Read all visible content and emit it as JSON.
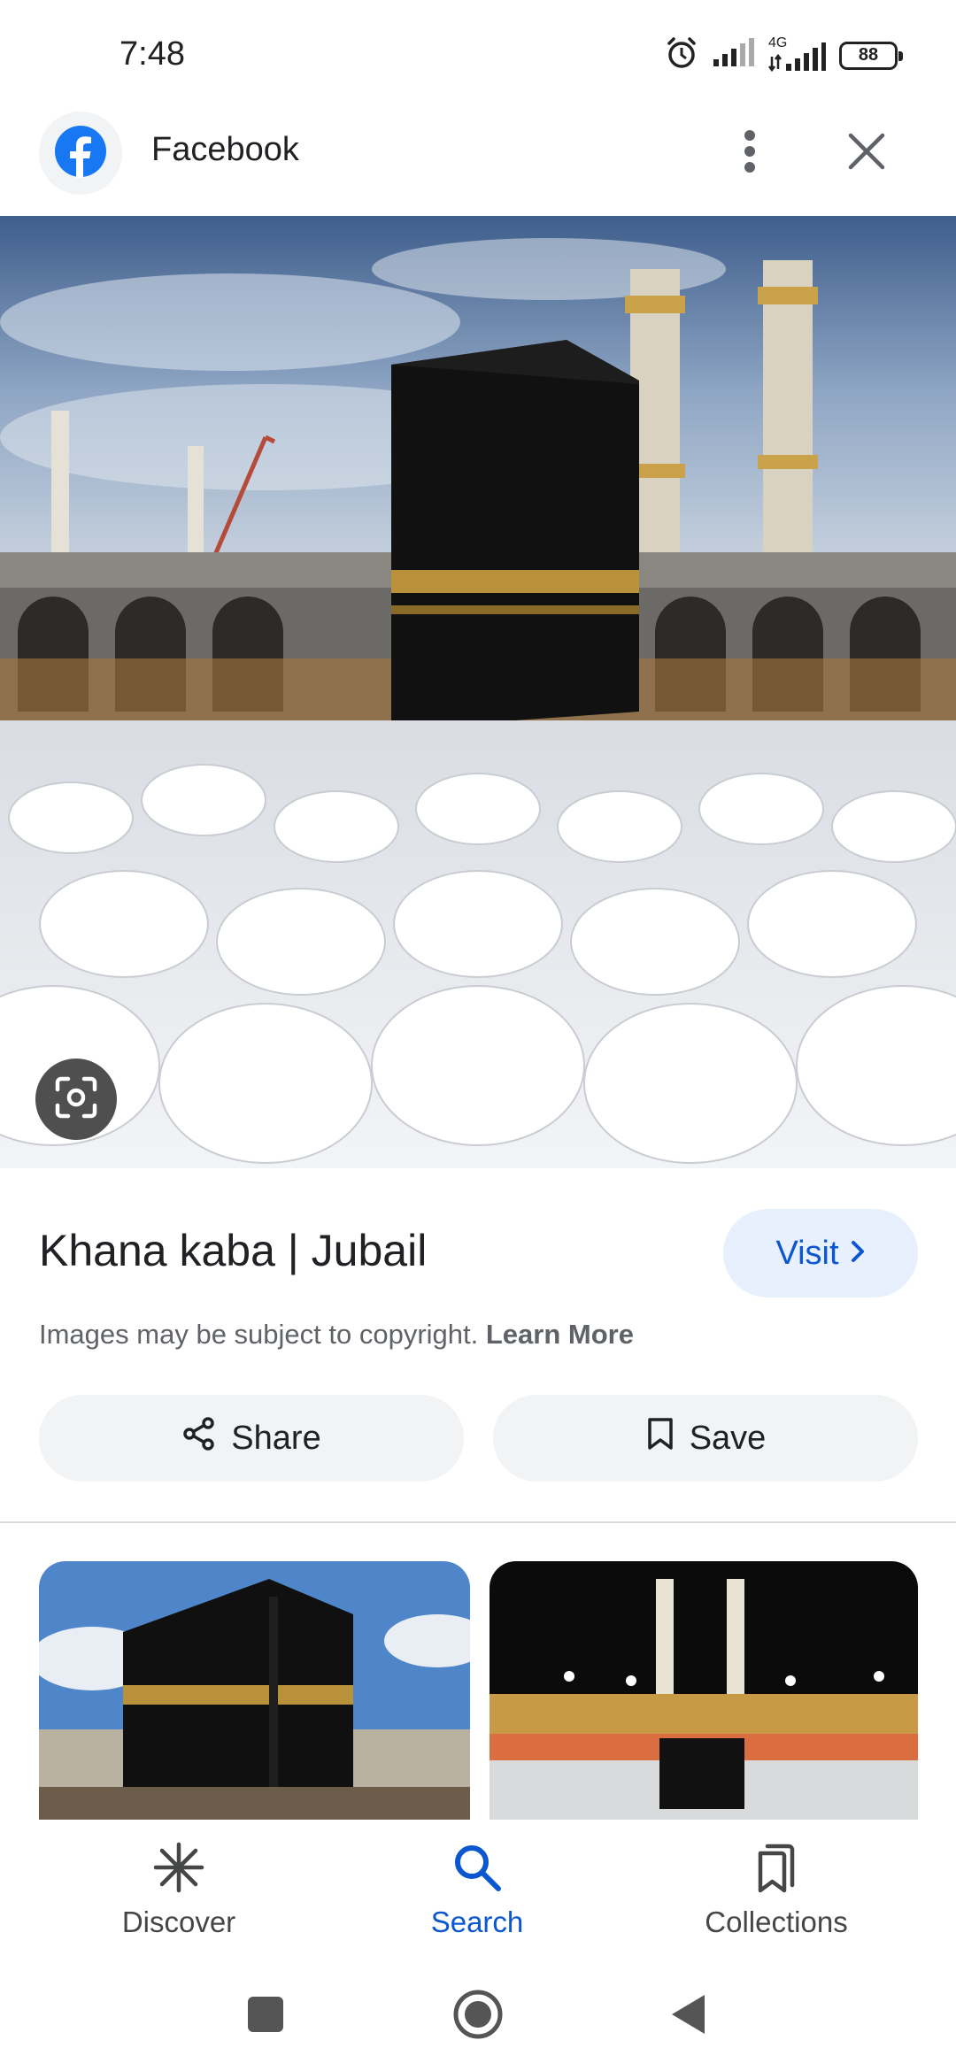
{
  "status_bar": {
    "time": "7:48",
    "network_label": "4G",
    "battery": "88"
  },
  "source": {
    "name": "Facebook",
    "logo_icon": "facebook-logo-icon",
    "brand_color": "#1877f2"
  },
  "result": {
    "title": "Khana kaba | Jubail",
    "visit_label": "Visit",
    "copyright_text": "Images may be subject to copyright.",
    "learn_more_label": "Learn More"
  },
  "actions": {
    "share_label": "Share",
    "save_label": "Save"
  },
  "bottom_nav": {
    "items": [
      {
        "label": "Discover",
        "icon": "asterisk-icon",
        "active": false
      },
      {
        "label": "Search",
        "icon": "search-icon",
        "active": true
      },
      {
        "label": "Collections",
        "icon": "collections-icon",
        "active": false
      }
    ]
  },
  "colors": {
    "accent": "#0b57d0",
    "visit_bg": "#e8f0fe",
    "chip_bg": "#f1f3f4"
  }
}
